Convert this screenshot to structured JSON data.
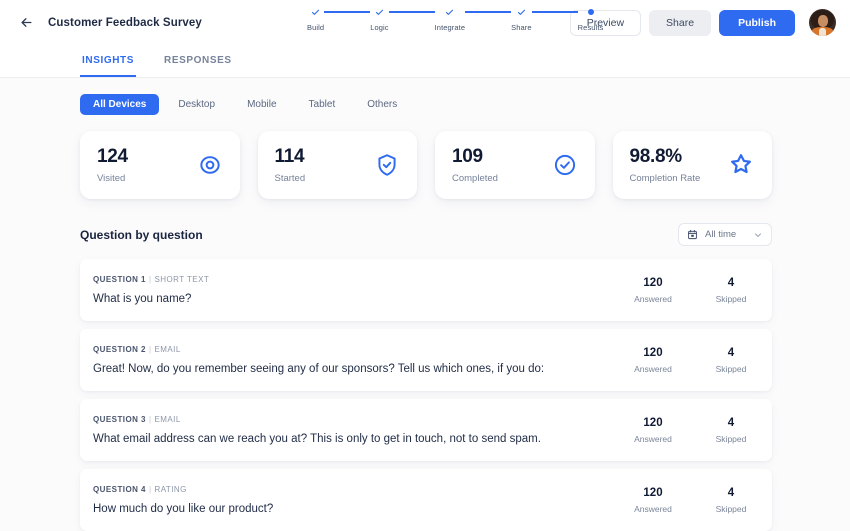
{
  "header": {
    "back_icon": "arrow-left-icon",
    "title": "Customer Feedback Survey",
    "steps": [
      {
        "label": "Build",
        "state": "done"
      },
      {
        "label": "Logic",
        "state": "done"
      },
      {
        "label": "Integrate",
        "state": "done"
      },
      {
        "label": "Share",
        "state": "done"
      },
      {
        "label": "Results",
        "state": "current"
      }
    ],
    "actions": {
      "preview": "Preview",
      "share": "Share",
      "publish": "Publish"
    },
    "avatar": "user-avatar"
  },
  "tabs": [
    {
      "label": "INSIGHTS",
      "active": true
    },
    {
      "label": "RESPONSES",
      "active": false
    }
  ],
  "device_filters": [
    {
      "label": "All Devices",
      "active": true
    },
    {
      "label": "Desktop",
      "active": false
    },
    {
      "label": "Mobile",
      "active": false
    },
    {
      "label": "Tablet",
      "active": false
    },
    {
      "label": "Others",
      "active": false
    }
  ],
  "stats": [
    {
      "value": "124",
      "label": "Visited",
      "icon": "eye-target-icon"
    },
    {
      "value": "114",
      "label": "Started",
      "icon": "shield-check-icon"
    },
    {
      "value": "109",
      "label": "Completed",
      "icon": "circle-check-icon"
    },
    {
      "value": "98.8%",
      "label": "Completion Rate",
      "icon": "star-outline-icon"
    }
  ],
  "section": {
    "title": "Question by question",
    "date_filter": {
      "value": "All time",
      "calendar_icon": "calendar-icon",
      "chevron_icon": "chevron-down-icon"
    }
  },
  "questions": [
    {
      "number": "QUESTION 1",
      "type": "SHORT TEXT",
      "text": "What is you name?",
      "answered_value": "120",
      "answered_label": "Answered",
      "skipped_value": "4",
      "skipped_label": "Skipped"
    },
    {
      "number": "QUESTION 2",
      "type": "EMAIL",
      "text": "Great! Now, do you remember seeing any of our sponsors? Tell us which ones, if you do:",
      "answered_value": "120",
      "answered_label": "Answered",
      "skipped_value": "4",
      "skipped_label": "Skipped"
    },
    {
      "number": "QUESTION 3",
      "type": "EMAIL",
      "text": "What email address can we reach you at? This is only to get in touch, not to send spam.",
      "answered_value": "120",
      "answered_label": "Answered",
      "skipped_value": "4",
      "skipped_label": "Skipped"
    },
    {
      "number": "QUESTION 4",
      "type": "RATING",
      "text": "How much do you like our product?",
      "answered_value": "120",
      "answered_label": "Answered",
      "skipped_value": "4",
      "skipped_label": "Skipped"
    }
  ],
  "colors": {
    "accent": "#2f6bf0",
    "text": "#1f2b45",
    "muted": "#76829a",
    "page_bg": "#fbfbfc",
    "card_bg": "#ffffff"
  }
}
